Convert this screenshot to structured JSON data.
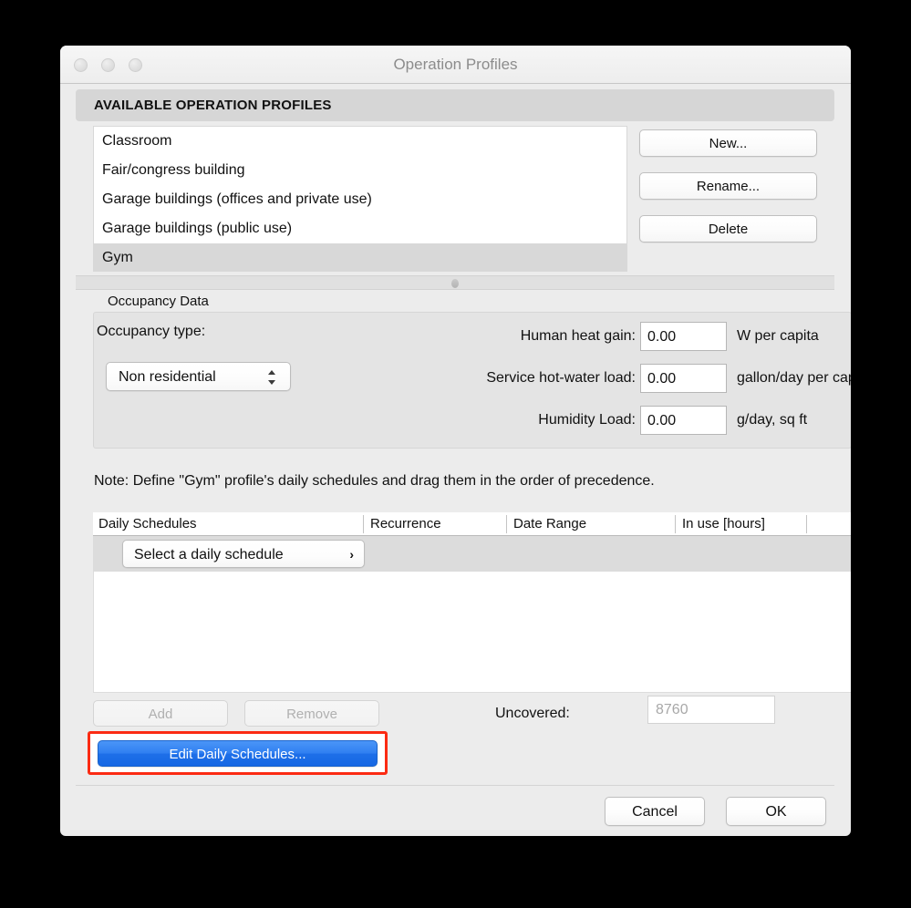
{
  "window": {
    "title": "Operation Profiles",
    "traffic_lights": [
      "close",
      "minimize",
      "zoom"
    ]
  },
  "section": {
    "header": "AVAILABLE OPERATION PROFILES"
  },
  "profiles": {
    "items": [
      {
        "label": "Classroom",
        "selected": false
      },
      {
        "label": "Fair/congress building",
        "selected": false
      },
      {
        "label": "Garage buildings (offices and private use)",
        "selected": false
      },
      {
        "label": "Garage buildings (public use)",
        "selected": false
      },
      {
        "label": "Gym",
        "selected": true
      }
    ],
    "buttons": {
      "new": "New...",
      "rename": "Rename...",
      "delete": "Delete"
    }
  },
  "occupancy": {
    "group_title": "Occupancy Data",
    "type_label": "Occupancy type:",
    "type_value": "Non residential",
    "fields": [
      {
        "label": "Human heat gain:",
        "value": "0.00",
        "unit": "W per capita"
      },
      {
        "label": "Service hot-water load:",
        "value": "0.00",
        "unit": "gallon/day per capita"
      },
      {
        "label": "Humidity Load:",
        "value": "0.00",
        "unit": "g/day, sq ft"
      }
    ]
  },
  "note": "Note: Define \"Gym\" profile's daily schedules and drag them in the order of precedence.",
  "schedules": {
    "columns": [
      "Daily Schedules",
      "Recurrence",
      "Date Range",
      "In use [hours]"
    ],
    "rows": [],
    "picker_label": "Select a daily schedule",
    "picker_chevron": "›",
    "add_label": "Add",
    "remove_label": "Remove",
    "uncovered_label": "Uncovered:",
    "uncovered_value": "8760"
  },
  "primary_action": {
    "label": "Edit Daily Schedules...",
    "highlight_color": "#fb2b13",
    "button_color": "#2f7ff1"
  },
  "footer": {
    "cancel": "Cancel",
    "ok": "OK"
  }
}
